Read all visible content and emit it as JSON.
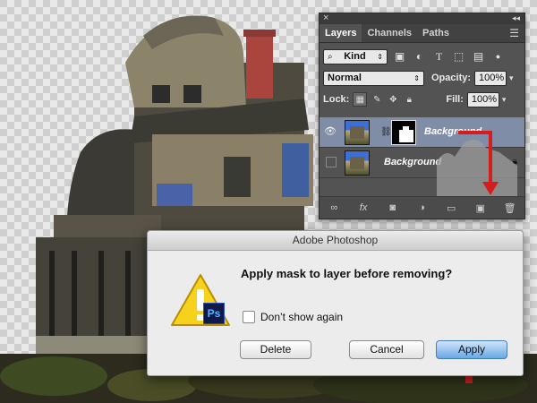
{
  "panel": {
    "tabs": [
      "Layers",
      "Channels",
      "Paths"
    ],
    "filter_label": "Kind",
    "blend_mode": "Normal",
    "opacity_label": "Opacity:",
    "opacity_value": "100%",
    "lock_label": "Lock:",
    "fill_label": "Fill:",
    "fill_value": "100%",
    "layers": [
      {
        "name": "Background",
        "selected": true,
        "has_mask": true
      },
      {
        "name": "Background",
        "selected": false,
        "has_mask": false
      }
    ]
  },
  "dialog": {
    "title": "Adobe Photoshop",
    "message": "Apply mask to layer before removing?",
    "badge": "Ps",
    "checkbox_label": "Don’t show again",
    "buttons": {
      "delete": "Delete",
      "cancel": "Cancel",
      "apply": "Apply"
    }
  },
  "colors": {
    "accent_red": "#d61c1c",
    "apply_blue": "#6aa7e5"
  }
}
